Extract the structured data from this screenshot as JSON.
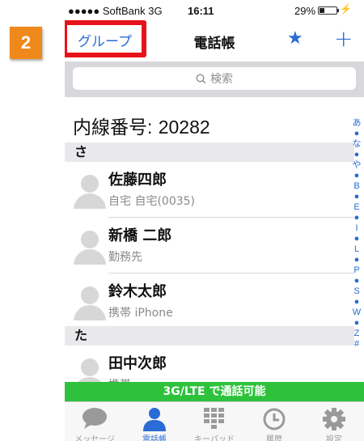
{
  "step_badge": "2",
  "status_bar": {
    "carrier": "●●●●● SoftBank  3G",
    "time": "16:11",
    "battery": "29%"
  },
  "navbar": {
    "group_label": "グループ",
    "title": "電話帳"
  },
  "search": {
    "placeholder": "検索"
  },
  "extension": {
    "label": "内線番号:",
    "number": "20282"
  },
  "sections": [
    {
      "header": "さ",
      "contacts": [
        {
          "name": "佐藤四郎",
          "detail": "自宅 自宅(0035)"
        },
        {
          "name": "新橋 二郎",
          "detail": "勤務先"
        },
        {
          "name": "鈴木太郎",
          "detail": "携帯 iPhone"
        }
      ]
    },
    {
      "header": "た",
      "contacts": [
        {
          "name": "田中次郎",
          "detail": "携帯"
        }
      ]
    }
  ],
  "index_bar": [
    "あ",
    "●",
    "な",
    "●",
    "や",
    "●",
    "B",
    "●",
    "E",
    "●",
    "I",
    "●",
    "L",
    "●",
    "P",
    "●",
    "S",
    "●",
    "W",
    "●",
    "Z",
    "#"
  ],
  "network_banner": "3G/LTE で通話可能",
  "tabs": [
    {
      "label": "メッセージ",
      "icon": "chat-bubble-icon"
    },
    {
      "label": "電話帳",
      "icon": "person-icon"
    },
    {
      "label": "キーパッド",
      "icon": "keypad-icon"
    },
    {
      "label": "履歴",
      "icon": "clock-icon"
    },
    {
      "label": "設定",
      "icon": "gear-icon"
    }
  ],
  "colors": {
    "accent": "#2a6bd6",
    "highlight": "#e8121a",
    "badge": "#f0891b",
    "banner": "#2ec23c"
  }
}
